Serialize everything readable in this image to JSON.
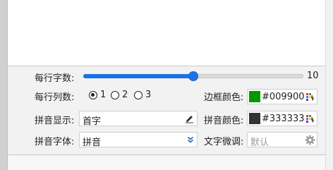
{
  "settings": {
    "chars_per_line": {
      "label": "每行字数:",
      "value": 10,
      "min": 0,
      "max": 16,
      "fraction": 0.5
    },
    "cols_per_line": {
      "label": "每行列数:",
      "options": [
        "1",
        "2",
        "3"
      ],
      "selected": "1"
    },
    "border_color": {
      "label": "边框颜色:",
      "value": "#009900",
      "swatch": "#009900",
      "icon": "palette-icon"
    },
    "pinyin_display": {
      "label": "拼音显示:",
      "value": "首字",
      "icon": "pencil-icon"
    },
    "pinyin_color": {
      "label": "拼音颜色:",
      "value": "#333333",
      "swatch": "#333333",
      "icon": "palette-icon"
    },
    "pinyin_font": {
      "label": "拼音字体:",
      "value": "拼音",
      "icon": "double-chevron-down-icon"
    },
    "text_adjust": {
      "label": "文字微调:",
      "placeholder": "默认",
      "icon": "gear-icon"
    }
  },
  "colors": {
    "accent": "#1a73e8",
    "border_green": "#009900",
    "pinyin_dark": "#333333"
  }
}
